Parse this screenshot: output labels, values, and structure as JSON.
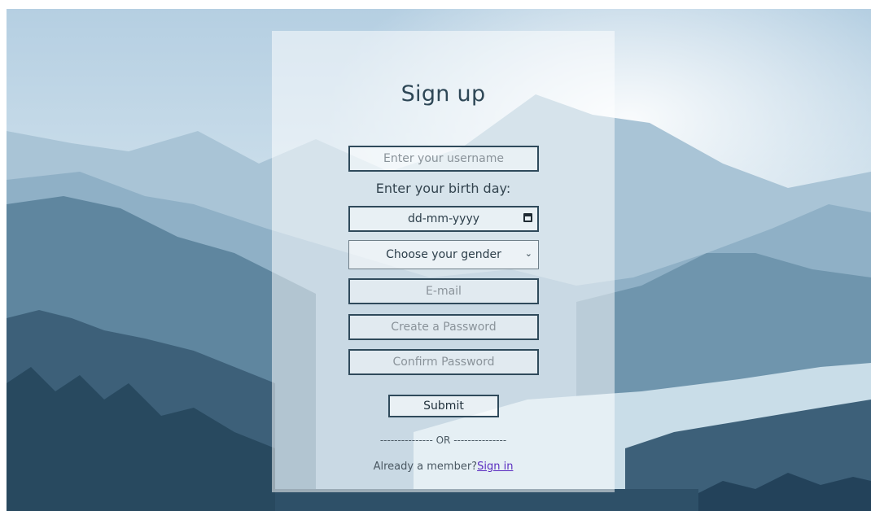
{
  "form": {
    "title": "Sign up",
    "username_placeholder": "Enter your username",
    "birthday_label": "Enter your birth day:",
    "birthday_placeholder": "dd-mm-yyyy",
    "gender_selected": "Choose your gender",
    "email_placeholder": "E-mail",
    "password_placeholder": "Create a Password",
    "confirm_placeholder": "Confirm Password",
    "submit_label": "Submit",
    "divider_text": "--------------- OR ---------------",
    "member_text": "Already a member?",
    "signin_link": "Sign in"
  },
  "icons": {
    "calendar": "calendar-icon",
    "dropdown": "chevron-down-icon"
  },
  "colors": {
    "border": "#2f4a5b",
    "title": "#2e4756",
    "link": "#5a2cc0"
  }
}
